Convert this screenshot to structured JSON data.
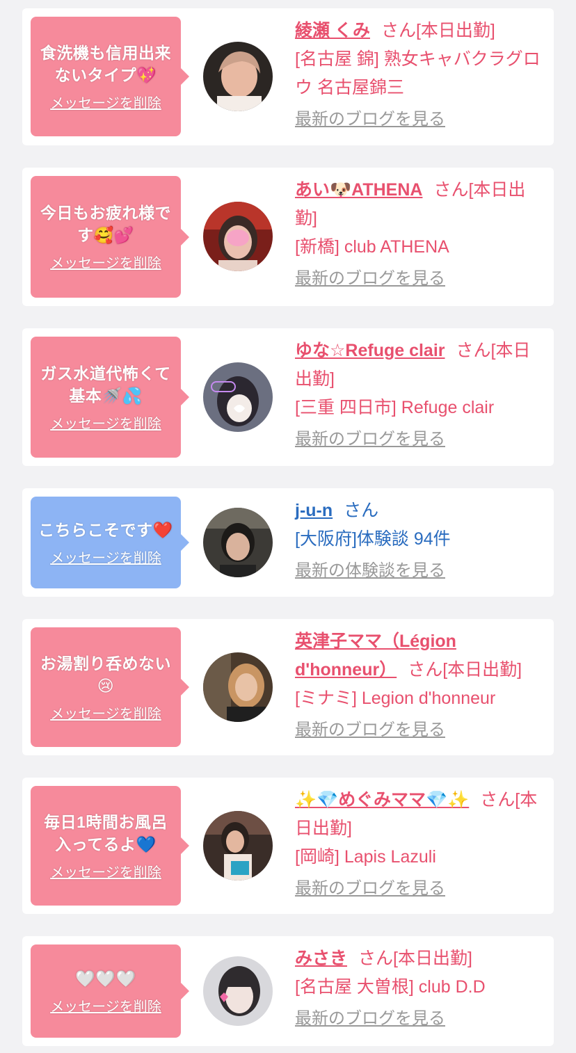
{
  "cards": [
    {
      "message": "食洗機も信用出来ないタイプ💖",
      "delete_label": "メッセージを削除",
      "name": "綾瀬 くみ",
      "san": "さん",
      "status": "[本日出勤]",
      "shop": "[名古屋 錦] 熟女キャバクラグロウ 名古屋錦三",
      "link": "最新のブログを見る",
      "bubble_color": "#f68a9b"
    },
    {
      "message": "今日もお疲れ様です🥰💕",
      "delete_label": "メッセージを削除",
      "name": "あい🐶ATHENA",
      "san": "さん",
      "status": "[本日出勤]",
      "shop": "[新橋] club ATHENA",
      "link": "最新のブログを見る",
      "bubble_color": "#f68a9b"
    },
    {
      "message": "ガス水道代怖くて基本🚿💦",
      "delete_label": "メッセージを削除",
      "name": "ゆな☆Refuge clair",
      "san": "さん",
      "status": "[本日出勤]",
      "shop": "[三重 四日市] Refuge clair",
      "link": "最新のブログを見る",
      "bubble_color": "#f68a9b"
    },
    {
      "message": "こちらこそです❤️",
      "delete_label": "メッセージを削除",
      "name": "j-u-n",
      "san": "さん",
      "status": "",
      "shop": "[大阪府]体験談 94件",
      "link": "最新の体験談を見る",
      "bubble_color": "#8db4f4"
    },
    {
      "message": "お湯割り呑めない😢",
      "delete_label": "メッセージを削除",
      "name": "英津子ママ（Légion d'honneur）",
      "san": "さん",
      "status": "[本日出勤]",
      "shop": "[ミナミ] Legion d'honneur",
      "link": "最新のブログを見る",
      "bubble_color": "#f68a9b"
    },
    {
      "message": "毎日1時間お風呂入ってるよ💙",
      "delete_label": "メッセージを削除",
      "name": "✨💎めぐみママ💎✨",
      "san": "さん",
      "status": "[本日出勤]",
      "shop": "[岡崎] Lapis Lazuli",
      "link": "最新のブログを見る",
      "bubble_color": "#f68a9b"
    },
    {
      "message": "🤍🤍🤍",
      "delete_label": "メッセージを削除",
      "name": "みさき",
      "san": "さん",
      "status": "[本日出勤]",
      "shop": "[名古屋 大曽根] club D.D",
      "link": "最新のブログを見る",
      "bubble_color": "#f68a9b"
    }
  ]
}
